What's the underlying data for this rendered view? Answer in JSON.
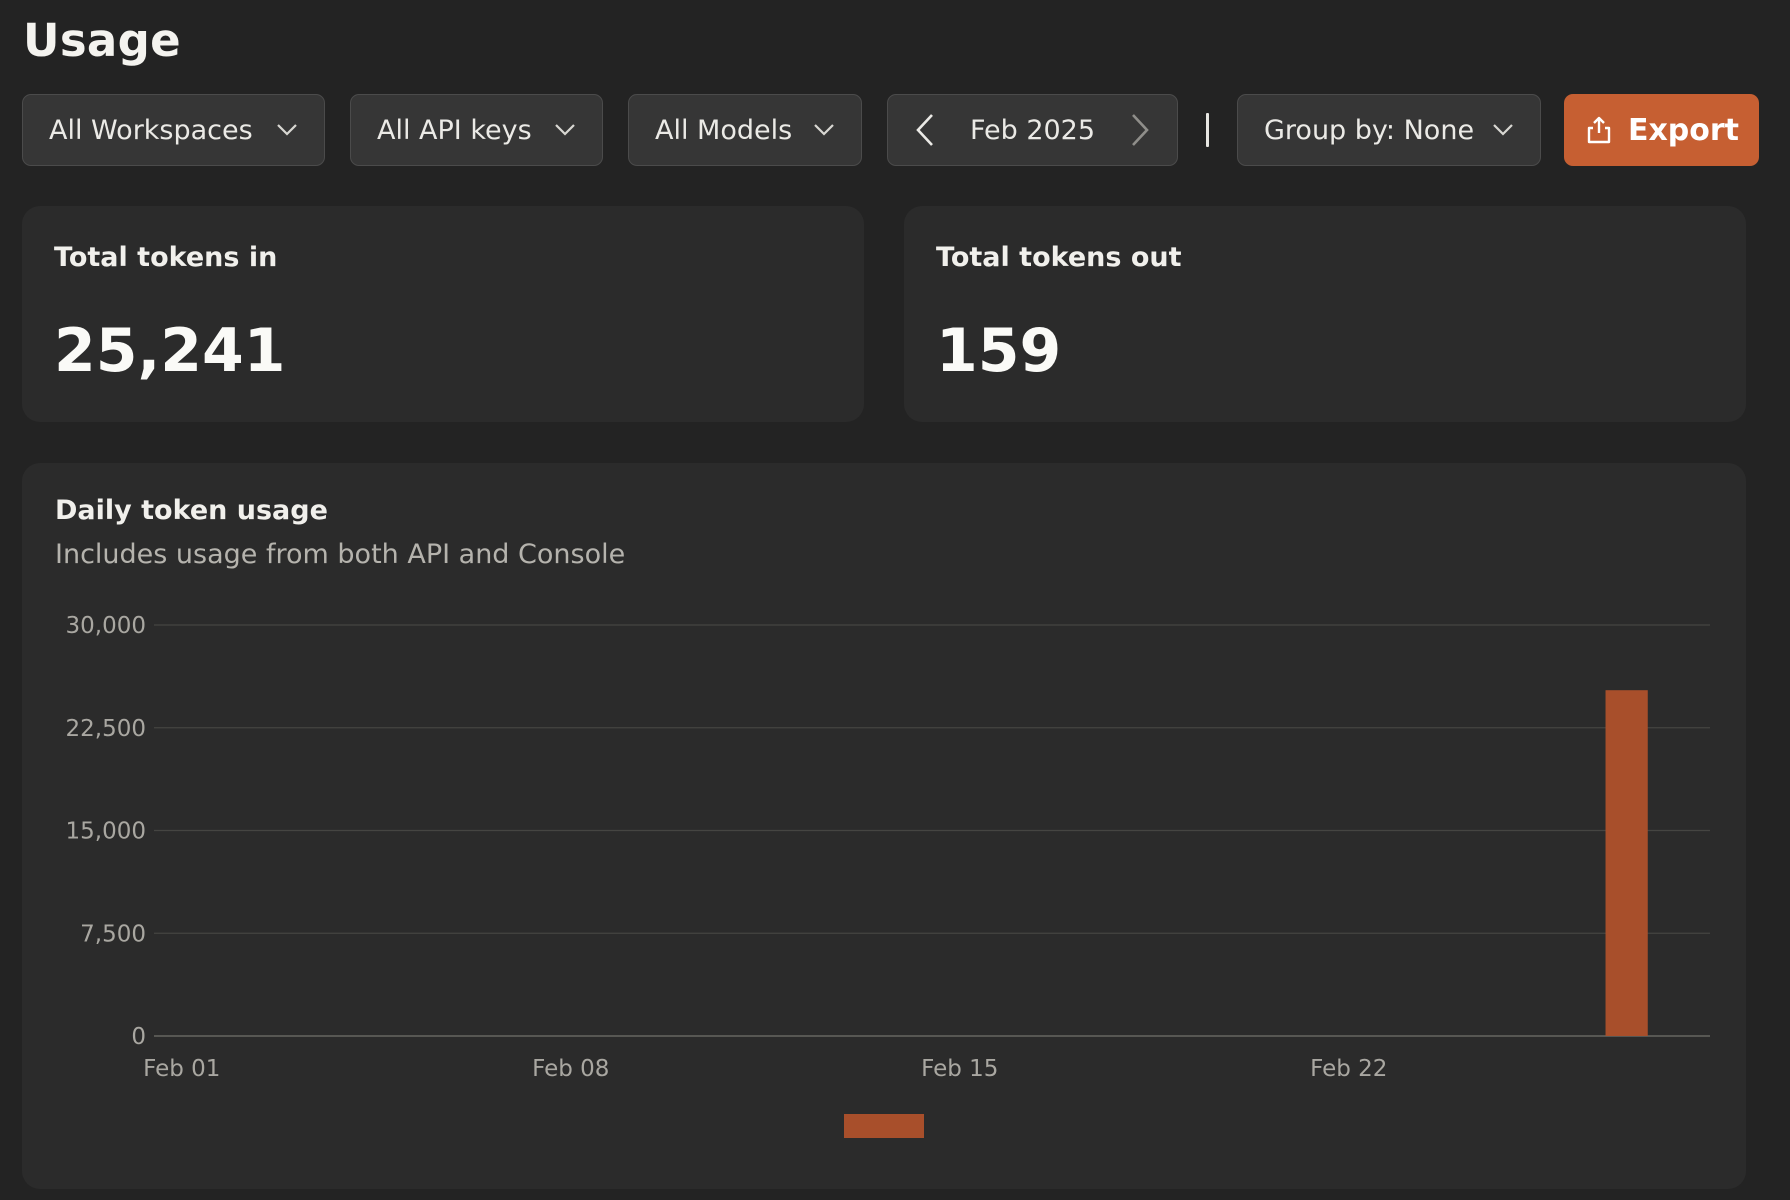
{
  "page": {
    "title": "Usage"
  },
  "toolbar": {
    "workspaces": "All Workspaces",
    "api_keys": "All API keys",
    "models": "All Models",
    "month": "Feb 2025",
    "group_by": "Group by: None",
    "export_label": "Export"
  },
  "stats": {
    "tokens_in": {
      "label": "Total tokens in",
      "value": "25,241"
    },
    "tokens_out": {
      "label": "Total tokens out",
      "value": "159"
    }
  },
  "chart": {
    "title": "Daily token usage",
    "subtitle": "Includes usage from both API and Console"
  },
  "colors": {
    "accent": "#c65f32",
    "bar": "#a84f2b",
    "background": "#232323",
    "card": "#2b2b2b"
  },
  "icons": [
    "chevron-down-icon",
    "chevron-left-icon",
    "chevron-right-icon",
    "export-icon"
  ],
  "chart_data": {
    "type": "bar",
    "title": "Daily token usage",
    "subtitle": "Includes usage from both API and Console",
    "xlabel": "",
    "ylabel": "",
    "x_tick_labels": [
      "Feb 01",
      "Feb 08",
      "Feb 15",
      "Feb 22"
    ],
    "y_tick_labels": [
      "30,000",
      "22,500",
      "15,000",
      "7,500",
      "0"
    ],
    "y_ticks": [
      30000,
      22500,
      15000,
      7500,
      0
    ],
    "ylim": [
      0,
      30000
    ],
    "xlim": [
      "2025-02-01",
      "2025-02-28"
    ],
    "grid": true,
    "legend": "bottom-center",
    "categories": [
      "2025-02-27"
    ],
    "series": [
      {
        "values": [
          25241
        ],
        "color": "#a84f2b"
      }
    ]
  }
}
